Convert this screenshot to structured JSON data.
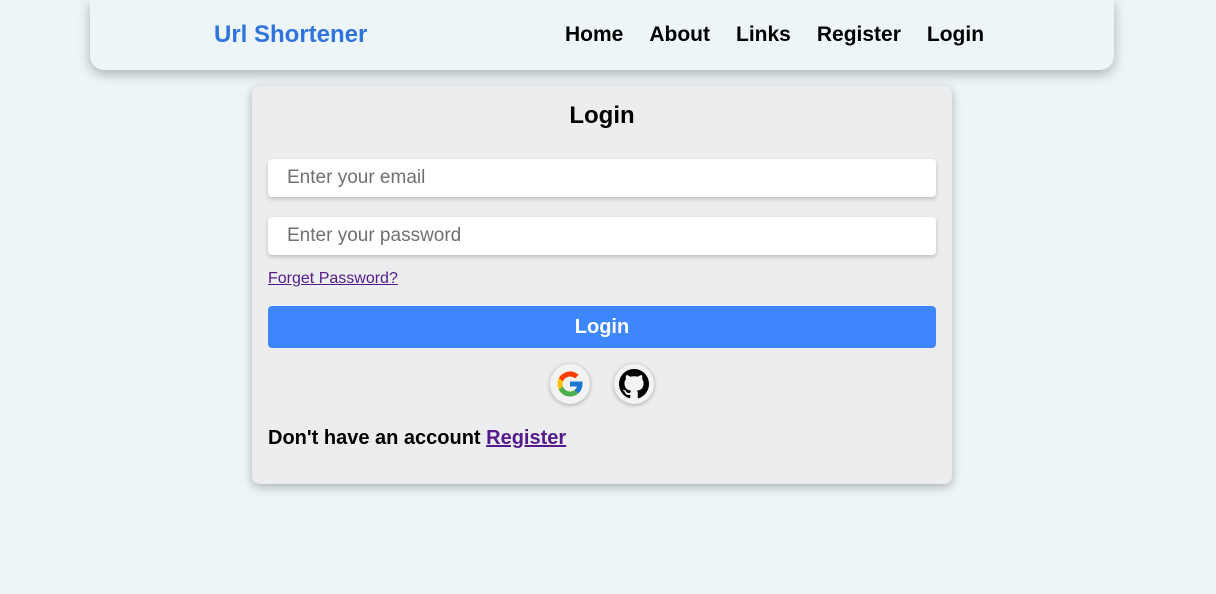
{
  "navbar": {
    "brand": "Url Shortener",
    "links": [
      "Home",
      "About",
      "Links",
      "Register",
      "Login"
    ]
  },
  "login_card": {
    "title": "Login",
    "email_placeholder": "Enter your email",
    "password_placeholder": "Enter your password",
    "forgot_password": "Forget Password?",
    "login_button": "Login",
    "social": [
      {
        "name": "google-icon"
      },
      {
        "name": "github-icon"
      }
    ],
    "register_prompt": "Don't have an account",
    "register_link": "Register"
  },
  "colors": {
    "background": "#edf5f8",
    "brand": "#2f74de",
    "card": "#ecedef",
    "primary_button": "#3d86fb",
    "visited_link": "#551a8b"
  }
}
